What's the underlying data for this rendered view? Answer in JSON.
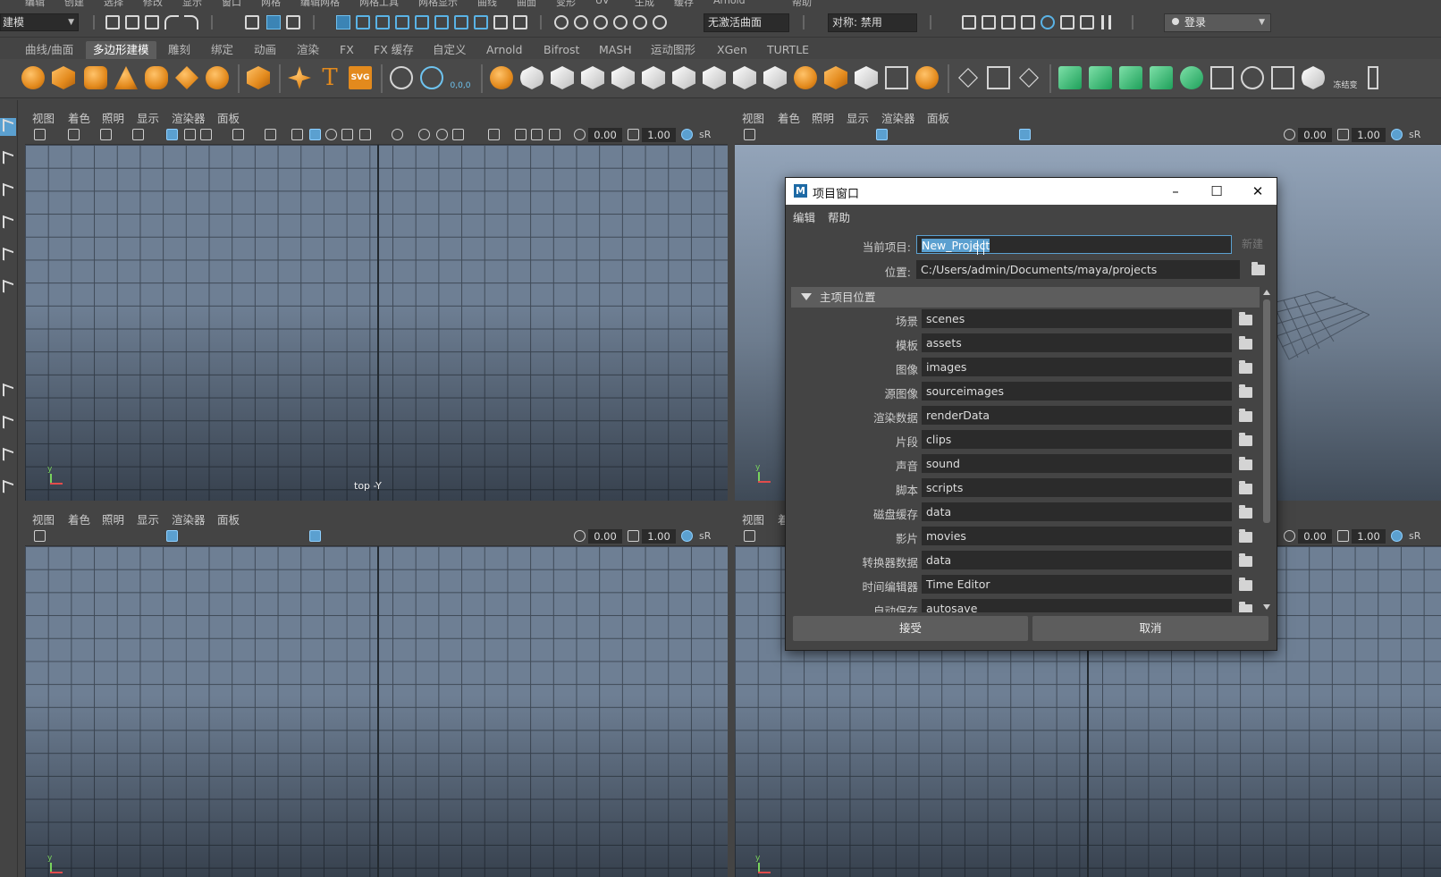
{
  "menubar": [
    "编辑",
    "创建",
    "选择",
    "修改",
    "显示",
    "窗口",
    "网格",
    "编辑网格",
    "网格工具",
    "网格显示",
    "曲线",
    "曲面",
    "变形",
    "UV",
    "生成",
    "缓存",
    "Arnold",
    "帮助"
  ],
  "statusline": {
    "mode": "建模",
    "live_surface": "无激活曲面",
    "symmetry": "对称: 禁用",
    "login": "登录"
  },
  "shelf_tabs": [
    "曲线/曲面",
    "多边形建模",
    "雕刻",
    "绑定",
    "动画",
    "渲染",
    "FX",
    "FX 缓存",
    "自定义",
    "Arnold",
    "Bifrost",
    "MASH",
    "运动图形",
    "XGen",
    "TURTLE"
  ],
  "shelf_active": "多边形建模",
  "shelf_icons": {
    "text_tool": "T",
    "svg_tool": "SVG",
    "snap_readout": "0,0,0",
    "freeze_label": "冻结变"
  },
  "viewport_menu": [
    "视图",
    "着色",
    "照明",
    "显示",
    "渲染器",
    "面板"
  ],
  "viewport_menu_short": [
    "视图",
    "着"
  ],
  "viewport_values": {
    "exposure": "0.00",
    "gamma": "1.00",
    "color_space": "sR"
  },
  "viewport_labels": {
    "top_left": "top -Y",
    "axis_y": "y"
  },
  "dialog": {
    "title": "项目窗口",
    "menu": [
      "编辑",
      "帮助"
    ],
    "current_project_label": "当前项目:",
    "current_project_value": "New_Project",
    "new_button": "新建",
    "location_label": "位置:",
    "location_value": "C:/Users/admin/Documents/maya/projects",
    "section_title": "主项目位置",
    "rows": [
      {
        "label": "场景",
        "value": "scenes"
      },
      {
        "label": "模板",
        "value": "assets"
      },
      {
        "label": "图像",
        "value": "images"
      },
      {
        "label": "源图像",
        "value": "sourceimages"
      },
      {
        "label": "渲染数据",
        "value": "renderData"
      },
      {
        "label": "片段",
        "value": "clips"
      },
      {
        "label": "声音",
        "value": "sound"
      },
      {
        "label": "脚本",
        "value": "scripts"
      },
      {
        "label": "磁盘缓存",
        "value": "data"
      },
      {
        "label": "影片",
        "value": "movies"
      },
      {
        "label": "转换器数据",
        "value": "data"
      },
      {
        "label": "时间编辑器",
        "value": "Time Editor"
      },
      {
        "label": "自动保存",
        "value": "autosave"
      }
    ],
    "accept_button": "接受",
    "cancel_button": "取消"
  },
  "colors": {
    "accent": "#5ba0d0",
    "shelf_orange": "#e38a1d",
    "shelf_green": "#1ea05a",
    "viewport_grid": "#6e7f94"
  }
}
